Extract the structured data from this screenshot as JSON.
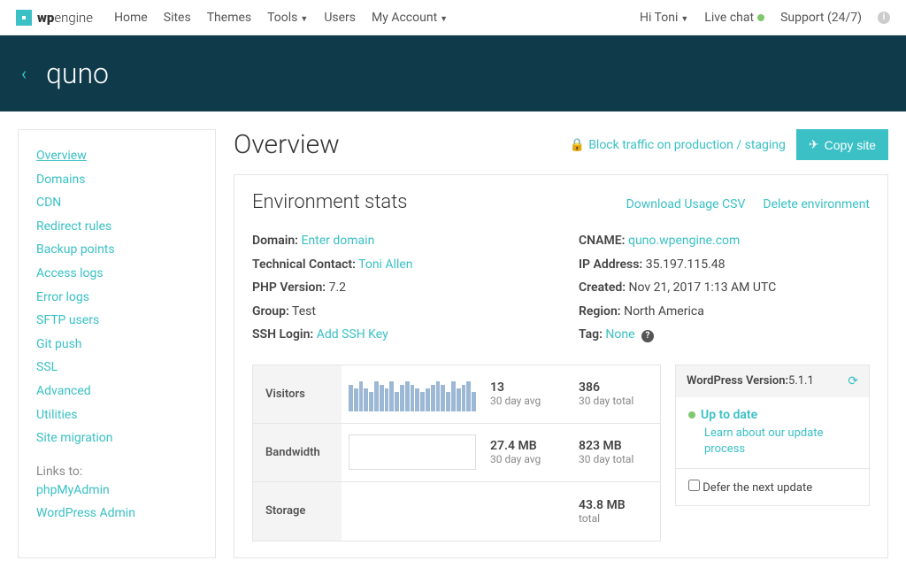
{
  "brand": {
    "logo_text_1": "wp",
    "logo_text_2": "engine"
  },
  "topnav": {
    "home": "Home",
    "sites": "Sites",
    "themes": "Themes",
    "tools": "Tools",
    "users": "Users",
    "account": "My Account"
  },
  "topright": {
    "greeting": "Hi Toni",
    "livechat": "Live chat",
    "support": "Support (24/7)"
  },
  "header": {
    "site_name": "quno"
  },
  "sidebar": {
    "items": [
      "Overview",
      "Domains",
      "CDN",
      "Redirect rules",
      "Backup points",
      "Access logs",
      "Error logs",
      "SFTP users",
      "Git push",
      "SSL",
      "Advanced",
      "Utilities",
      "Site migration"
    ],
    "links_to_label": "Links to:",
    "links": [
      "phpMyAdmin",
      "WordPress Admin"
    ]
  },
  "page": {
    "title": "Overview",
    "block_traffic": "Block traffic on production / staging",
    "copy_site": "Copy site"
  },
  "panel": {
    "title": "Environment stats",
    "download_csv": "Download Usage CSV",
    "delete_env": "Delete environment"
  },
  "env": {
    "domain_label": "Domain:",
    "domain_value": "Enter domain",
    "contact_label": "Technical Contact:",
    "contact_value": "Toni Allen",
    "php_label": "PHP Version:",
    "php_value": "7.2",
    "group_label": "Group:",
    "group_value": "Test",
    "ssh_label": "SSH Login:",
    "ssh_value": "Add SSH Key",
    "cname_label": "CNAME:",
    "cname_value": "quno.wpengine.com",
    "ip_label": "IP Address:",
    "ip_value": "35.197.115.48",
    "created_label": "Created:",
    "created_value": "Nov 21, 2017 1:13 AM UTC",
    "region_label": "Region:",
    "region_value": "North America",
    "tag_label": "Tag:",
    "tag_value": "None"
  },
  "stats": {
    "visitors_label": "Visitors",
    "visitors_avg": "13",
    "visitors_avg_sub": "30 day avg",
    "visitors_total": "386",
    "visitors_total_sub": "30 day total",
    "bandwidth_label": "Bandwidth",
    "bandwidth_avg": "27.4 MB",
    "bandwidth_avg_sub": "30 day avg",
    "bandwidth_total": "823 MB",
    "bandwidth_total_sub": "30 day total",
    "storage_label": "Storage",
    "storage_total": "43.8 MB",
    "storage_total_sub": "total"
  },
  "wp": {
    "version_label": "WordPress Version: ",
    "version": "5.1.1",
    "status": "Up to date",
    "learn": "Learn about our update process",
    "defer": "Defer the next update"
  }
}
